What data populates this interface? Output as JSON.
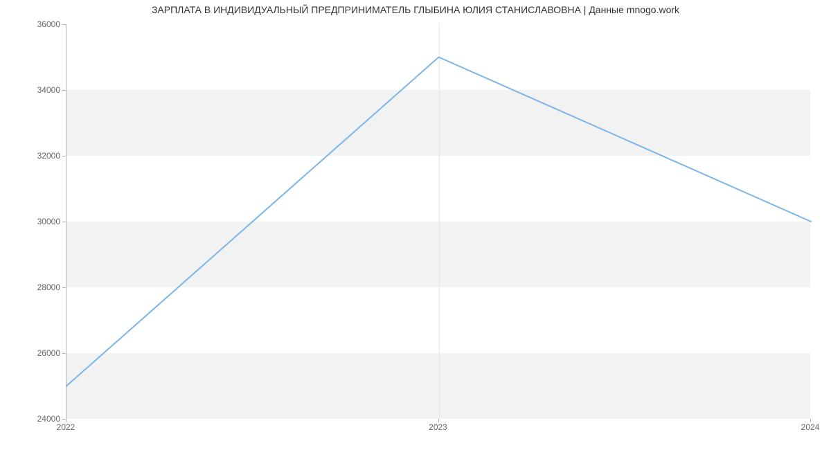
{
  "chart_data": {
    "type": "line",
    "title": "ЗАРПЛАТА В ИНДИВИДУАЛЬНЫЙ ПРЕДПРИНИМАТЕЛЬ ГЛЫБИНА ЮЛИЯ СТАНИСЛАВОВНА | Данные mnogo.work",
    "categories": [
      "2022",
      "2023",
      "2024"
    ],
    "values": [
      25000,
      35000,
      30000
    ],
    "y_ticks": [
      24000,
      26000,
      28000,
      30000,
      32000,
      34000,
      36000
    ],
    "ylim": [
      24000,
      36000
    ],
    "line_color": "#7cb5ec",
    "xlabel": "",
    "ylabel": ""
  }
}
